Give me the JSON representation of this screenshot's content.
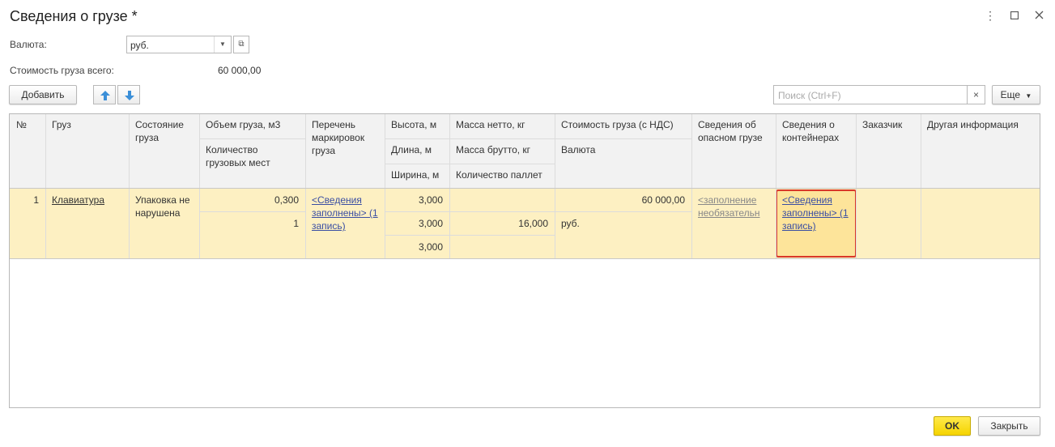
{
  "window": {
    "title": "Сведения о грузе *"
  },
  "form": {
    "currency_label": "Валюта:",
    "currency_value": "руб.",
    "total_label": "Стоимость груза всего:",
    "total_value": "60 000,00"
  },
  "toolbar": {
    "add_label": "Добавить",
    "search_placeholder": "Поиск (Ctrl+F)",
    "clear_symbol": "×",
    "more_label": "Еще"
  },
  "table": {
    "headers": {
      "num": "№",
      "cargo": "Груз",
      "state": "Состояние груза",
      "volume": "Объем груза, м3",
      "places": "Количество грузовых мест",
      "markings": "Перечень маркировок груза",
      "height": "Высота, м",
      "length": "Длина, м",
      "width": "Ширина, м",
      "net": "Масса нетто, кг",
      "gross": "Масса брутто, кг",
      "pallets": "Количество паллет",
      "cost": "Стоимость груза (с НДС)",
      "currency": "Валюта",
      "danger": "Сведения об опасном грузе",
      "containers": "Сведения о контейнерах",
      "customer": "Заказчик",
      "other": "Другая информация"
    },
    "row": {
      "num": "1",
      "cargo": "Клавиатура",
      "state": "Упаковка не нарушена",
      "volume": "0,300",
      "places": "1",
      "markings": "<Сведения заполнены> (1 запись)",
      "height": "3,000",
      "length": "3,000",
      "width": "3,000",
      "net": "",
      "gross": "16,000",
      "cost": "60 000,00",
      "currency": "руб.",
      "danger": "<заполнение необязательн",
      "containers": "<Сведения заполнены> (1 запись)"
    }
  },
  "footer": {
    "ok_label": "OK",
    "close_label": "Закрыть"
  },
  "colors": {
    "accent": "#f5d400",
    "selection": "#fdf0c2",
    "highlight_border": "#d9382a",
    "link": "#3a4ea3"
  }
}
